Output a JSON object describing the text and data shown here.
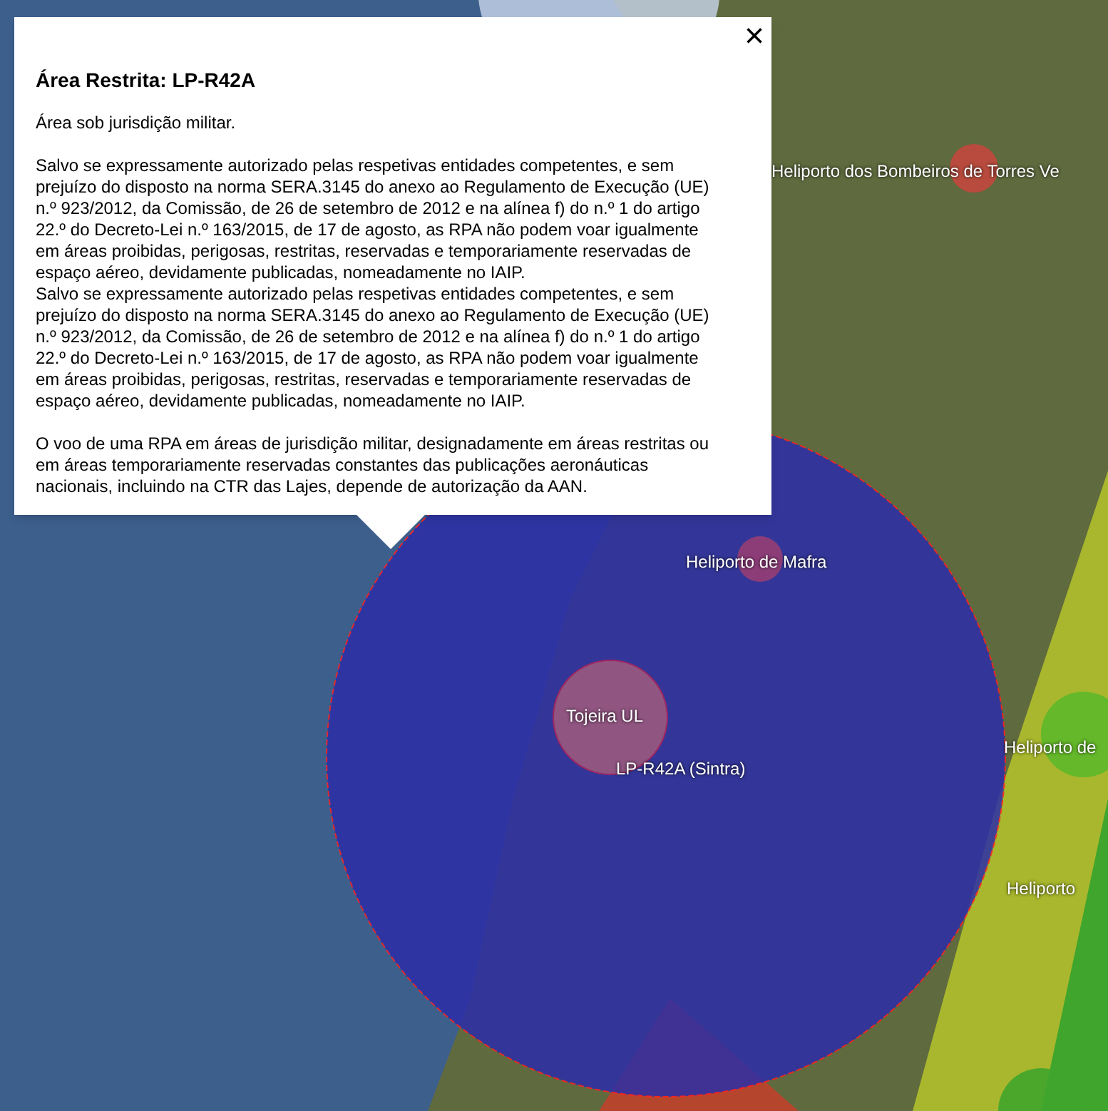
{
  "popup": {
    "title": "Área Restrita: LP-R42A",
    "close": "×",
    "sections": [
      [
        "Área sob jurisdição militar."
      ],
      [
        "Salvo se expressamente autorizado pelas respetivas entidades competentes, e sem prejuízo do disposto na norma SERA.3145 do anexo ao Regulamento de Execução (UE) n.º 923/2012, da Comissão, de 26 de setembro de 2012 e na alínea f) do n.º 1 do artigo 22.º do Decreto-Lei n.º 163/2015, de 17 de agosto, as RPA não podem voar igualmente em áreas proibidas, perigosas, restritas, reservadas e temporariamente reservadas de espaço aéreo, devidamente publicadas, nomeadamente no IAIP.",
        "Salvo se expressamente autorizado pelas respetivas entidades competentes, e sem prejuízo do disposto na norma SERA.3145 do anexo ao Regulamento de Execução (UE) n.º 923/2012, da Comissão, de 26 de setembro de 2012 e na alínea f) do n.º 1 do artigo 22.º do Decreto-Lei n.º 163/2015, de 17 de agosto, as RPA não podem voar igualmente em áreas proibidas, perigosas, restritas, reservadas e temporariamente reservadas de espaço aéreo, devidamente publicadas, nomeadamente no IAIP."
      ],
      [
        "O voo de uma RPA em áreas de jurisdição militar, designadamente em áreas restritas ou em áreas temporariamente reservadas constantes das publicações aeronáuticas nacionais, incluindo na CTR das Lajes, depende de autorização da AAN."
      ]
    ]
  },
  "map_labels": [
    "Heliporto dos Bombeiros de Torres Ve",
    "Heliporto de Mafra",
    "Tojeira UL",
    "LP-R42A (Sintra)",
    "Heliporto de",
    "Heliporto"
  ]
}
